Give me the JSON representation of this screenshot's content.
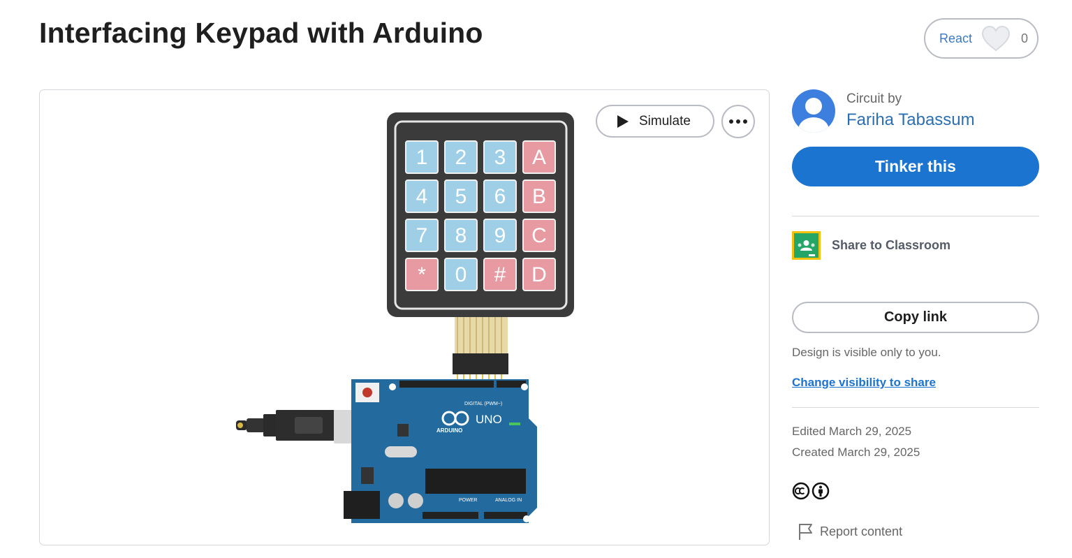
{
  "page": {
    "title": "Interfacing Keypad with Arduino"
  },
  "react": {
    "label": "React",
    "count": "0"
  },
  "canvas": {
    "simulate_label": "Simulate",
    "keypad_keys": [
      "1",
      "2",
      "3",
      "A",
      "4",
      "5",
      "6",
      "B",
      "7",
      "8",
      "9",
      "C",
      "*",
      "0",
      "#",
      "D"
    ],
    "board_label": "UNO",
    "board_brand": "ARDUINO",
    "digital_label": "DIGITAL (PWM~)",
    "power_label": "POWER",
    "analog_label": "ANALOG IN"
  },
  "sidebar": {
    "circuit_by": "Circuit by",
    "author": "Fariha Tabassum",
    "tinker_label": "Tinker this",
    "share_classroom": "Share to Classroom",
    "copy_link": "Copy link",
    "visibility_note": "Design is visible only to you.",
    "visibility_link": "Change visibility to share",
    "edited": "Edited March 29, 2025",
    "created": "Created March 29, 2025",
    "report": "Report content"
  },
  "colors": {
    "accent": "#1b74d0",
    "link": "#2c6fb1",
    "keypad_blue": "#9fcfe6",
    "keypad_red": "#e79aa1",
    "board_blue": "#236b9e"
  }
}
